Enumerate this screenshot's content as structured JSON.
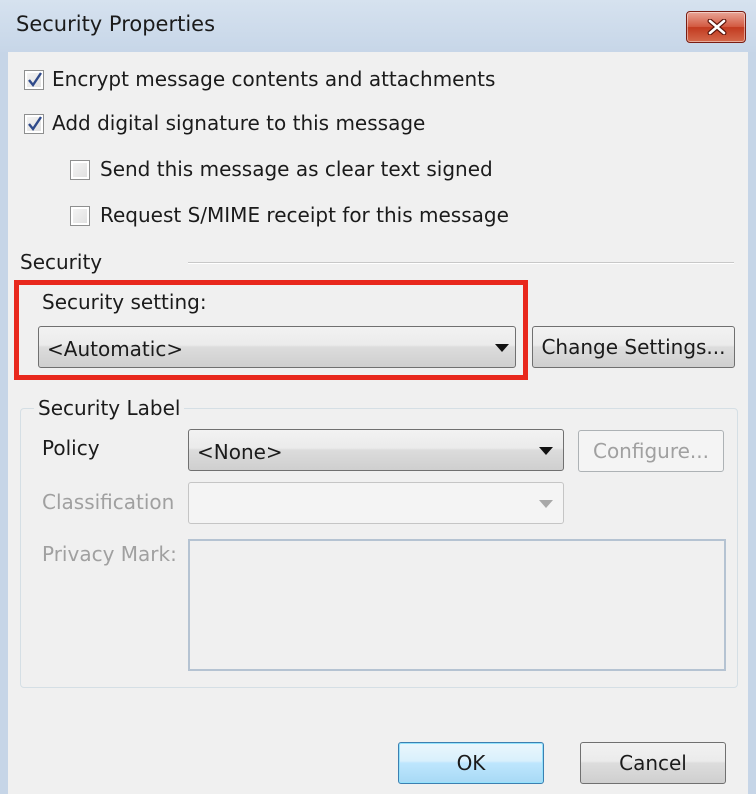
{
  "window": {
    "title": "Security Properties",
    "close_icon": "close-icon"
  },
  "options": {
    "encrypt_label": "Encrypt message contents and attachments",
    "encrypt_checked": true,
    "signature_label": "Add digital signature to this message",
    "signature_checked": true,
    "clear_text_label": "Send this message as clear text signed",
    "clear_text_checked": false,
    "receipt_label": "Request S/MIME receipt for this message",
    "receipt_checked": false
  },
  "security": {
    "section_label": "Security",
    "setting_label": "Security setting:",
    "setting_value": "<Automatic>",
    "change_settings_label": "Change Settings...",
    "highlight_color": "#e8281d"
  },
  "security_label": {
    "group_label": "Security Label",
    "policy_label": "Policy",
    "policy_value": "<None>",
    "configure_label": "Configure...",
    "classification_label": "Classification",
    "classification_value": "",
    "privacy_mark_label": "Privacy Mark:",
    "privacy_mark_value": ""
  },
  "footer": {
    "ok_label": "OK",
    "cancel_label": "Cancel"
  }
}
